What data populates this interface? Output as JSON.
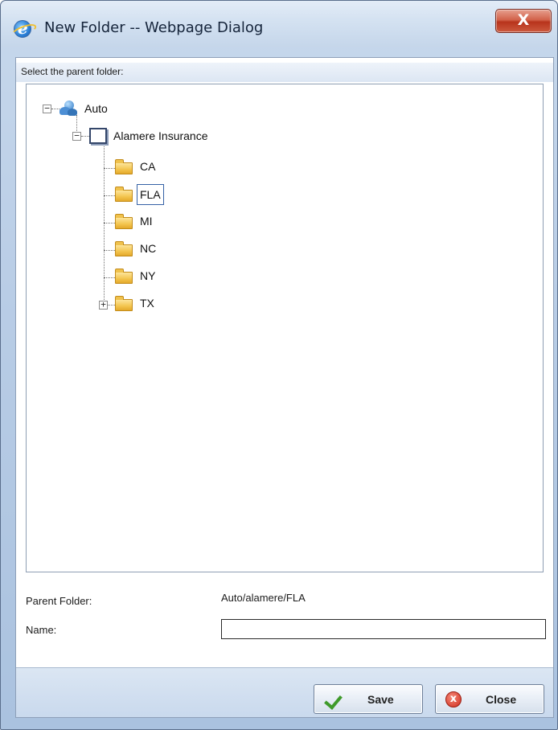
{
  "window": {
    "title": "New Folder -- Webpage Dialog",
    "close_glyph": "X",
    "icon": "ie-icon"
  },
  "dialog": {
    "section_label": "Select the parent folder:",
    "tree": {
      "root": {
        "label": "Auto",
        "icon": "globe-people-icon",
        "expanded": true
      },
      "company": {
        "label": "Alamere Insurance",
        "icon": "company-icon",
        "expanded": true
      },
      "folders": [
        {
          "label": "CA",
          "has_children": false,
          "selected": false
        },
        {
          "label": "FLA",
          "has_children": false,
          "selected": true
        },
        {
          "label": "MI",
          "has_children": false,
          "selected": false
        },
        {
          "label": "NC",
          "has_children": false,
          "selected": false
        },
        {
          "label": "NY",
          "has_children": false,
          "selected": false
        },
        {
          "label": "TX",
          "has_children": true,
          "selected": false
        }
      ],
      "expander_collapse": "−",
      "expander_expand": "+"
    },
    "parent_folder_label": "Parent Folder:",
    "parent_folder_value": "Auto/alamere/FLA",
    "name_label": "Name:",
    "name_value": ""
  },
  "buttons": {
    "save_label": "Save",
    "close_label": "Close",
    "close_icon_glyph": "x"
  },
  "colors": {
    "selection_border": "#3561a6",
    "folder": "#f3c44d",
    "close_button": "#c2452c"
  }
}
